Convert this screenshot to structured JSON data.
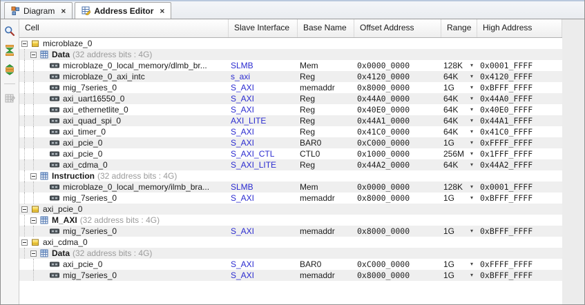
{
  "tabs": [
    {
      "label": "Diagram",
      "icon": "diagram-icon",
      "close": "×",
      "active": false
    },
    {
      "label": "Address Editor",
      "icon": "address-editor-icon",
      "close": "×",
      "active": true
    }
  ],
  "toolbar": {
    "icons": [
      {
        "name": "search-icon",
        "enabled": true
      },
      {
        "name": "collapse-all-icon",
        "enabled": true
      },
      {
        "name": "expand-all-icon",
        "enabled": true
      },
      {
        "name": "auto-assign-address-icon",
        "enabled": false
      }
    ]
  },
  "colors": {
    "link_blue": "#2b2bd0",
    "stripe_gray": "#efefef",
    "suffix_gray": "#9b9b9b"
  },
  "table": {
    "columns": [
      "Cell",
      "Slave Interface",
      "Base Name",
      "Offset Address",
      "Range",
      "High Address"
    ],
    "range_arrow": "▾",
    "rows": [
      {
        "kind": "cell",
        "cell": "microblaze_0",
        "guides": []
      },
      {
        "kind": "space",
        "cell": "Data",
        "suffix": "(32 address bits : 4G)",
        "guides": [
          7
        ]
      },
      {
        "kind": "segment",
        "cell": "microblaze_0_local_memory/dlmb_br...",
        "iface": "SLMB",
        "base": "Mem",
        "offset": "0x0000_0000",
        "range": "128K",
        "high": "0x0001_FFFF",
        "guides": [
          7,
          20
        ]
      },
      {
        "kind": "segment",
        "cell": "microblaze_0_axi_intc",
        "iface": "s_axi",
        "base": "Reg",
        "offset": "0x4120_0000",
        "range": "64K",
        "high": "0x4120_FFFF",
        "guides": [
          7,
          20
        ]
      },
      {
        "kind": "segment",
        "cell": "mig_7series_0",
        "iface": "S_AXI",
        "base": "memaddr",
        "offset": "0x8000_0000",
        "range": "1G",
        "high": "0xBFFF_FFFF",
        "guides": [
          7,
          20
        ]
      },
      {
        "kind": "segment",
        "cell": "axi_uart16550_0",
        "iface": "S_AXI",
        "base": "Reg",
        "offset": "0x44A0_0000",
        "range": "64K",
        "high": "0x44A0_FFFF",
        "guides": [
          7,
          20
        ]
      },
      {
        "kind": "segment",
        "cell": "axi_ethernetlite_0",
        "iface": "S_AXI",
        "base": "Reg",
        "offset": "0x40E0_0000",
        "range": "64K",
        "high": "0x40E0_FFFF",
        "guides": [
          7,
          20
        ]
      },
      {
        "kind": "segment",
        "cell": "axi_quad_spi_0",
        "iface": "AXI_LITE",
        "base": "Reg",
        "offset": "0x44A1_0000",
        "range": "64K",
        "high": "0x44A1_FFFF",
        "guides": [
          7,
          20
        ]
      },
      {
        "kind": "segment",
        "cell": "axi_timer_0",
        "iface": "S_AXI",
        "base": "Reg",
        "offset": "0x41C0_0000",
        "range": "64K",
        "high": "0x41C0_FFFF",
        "guides": [
          7,
          20
        ]
      },
      {
        "kind": "segment",
        "cell": "axi_pcie_0",
        "iface": "S_AXI",
        "base": "BAR0",
        "offset": "0xC000_0000",
        "range": "1G",
        "high": "0xFFFF_FFFF",
        "guides": [
          7,
          20
        ]
      },
      {
        "kind": "segment",
        "cell": "axi_pcie_0",
        "iface": "S_AXI_CTL",
        "base": "CTL0",
        "offset": "0x1000_0000",
        "range": "256M",
        "high": "0x1FFF_FFFF",
        "guides": [
          7,
          20
        ]
      },
      {
        "kind": "segment",
        "cell": "axi_cdma_0",
        "iface": "S_AXI_LITE",
        "base": "Reg",
        "offset": "0x44A2_0000",
        "range": "64K",
        "high": "0x44A2_FFFF",
        "guides": [
          7,
          20
        ]
      },
      {
        "kind": "space",
        "cell": "Instruction",
        "suffix": "(32 address bits : 4G)",
        "guides": [
          7
        ]
      },
      {
        "kind": "segment",
        "cell": "microblaze_0_local_memory/ilmb_bra...",
        "iface": "SLMB",
        "base": "Mem",
        "offset": "0x0000_0000",
        "range": "128K",
        "high": "0x0001_FFFF",
        "guides": [
          7,
          20
        ]
      },
      {
        "kind": "segment",
        "cell": "mig_7series_0",
        "iface": "S_AXI",
        "base": "memaddr",
        "offset": "0x8000_0000",
        "range": "1G",
        "high": "0xBFFF_FFFF",
        "guides": [
          7,
          20
        ]
      },
      {
        "kind": "cell",
        "cell": "axi_pcie_0",
        "guides": []
      },
      {
        "kind": "space",
        "cell": "M_AXI",
        "suffix": "(32 address bits : 4G)",
        "guides": [
          7
        ]
      },
      {
        "kind": "segment",
        "cell": "mig_7series_0",
        "iface": "S_AXI",
        "base": "memaddr",
        "offset": "0x8000_0000",
        "range": "1G",
        "high": "0xBFFF_FFFF",
        "guides": [
          7,
          20
        ]
      },
      {
        "kind": "cell",
        "cell": "axi_cdma_0",
        "guides": []
      },
      {
        "kind": "space",
        "cell": "Data",
        "suffix": "(32 address bits : 4G)",
        "guides": [
          7
        ]
      },
      {
        "kind": "segment",
        "cell": "axi_pcie_0",
        "iface": "S_AXI",
        "base": "BAR0",
        "offset": "0xC000_0000",
        "range": "1G",
        "high": "0xFFFF_FFFF",
        "guides": [
          20
        ]
      },
      {
        "kind": "segment",
        "cell": "mig_7series_0",
        "iface": "S_AXI",
        "base": "memaddr",
        "offset": "0x8000_0000",
        "range": "1G",
        "high": "0xBFFF_FFFF",
        "guides": [
          20
        ]
      }
    ]
  }
}
